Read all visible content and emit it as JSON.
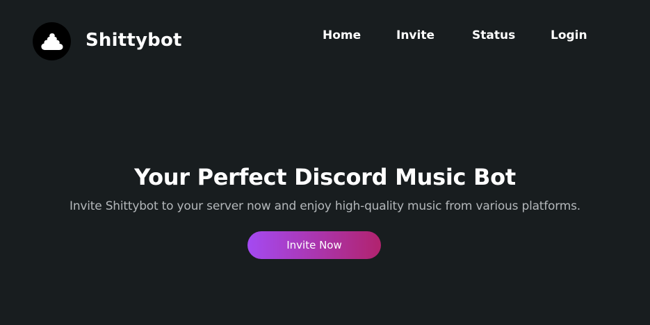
{
  "brand": {
    "name": "Shittybot",
    "logo_icon": "poop-cloud-icon",
    "logo_background": "#000000"
  },
  "nav": [
    {
      "label": "Home"
    },
    {
      "label": "Invite"
    },
    {
      "label": "Status"
    },
    {
      "label": "Login"
    }
  ],
  "hero": {
    "title": "Your Perfect Discord Music Bot",
    "subtitle": "Invite Shittybot to your server now and enjoy high-quality music from various platforms.",
    "cta_label": "Invite Now"
  },
  "colors": {
    "background": "#181d1f",
    "text": "#ffffff",
    "subtitle_text": "#b4b8bb",
    "cta_gradient_start": "#a44af2",
    "cta_gradient_end": "#b1236e"
  }
}
